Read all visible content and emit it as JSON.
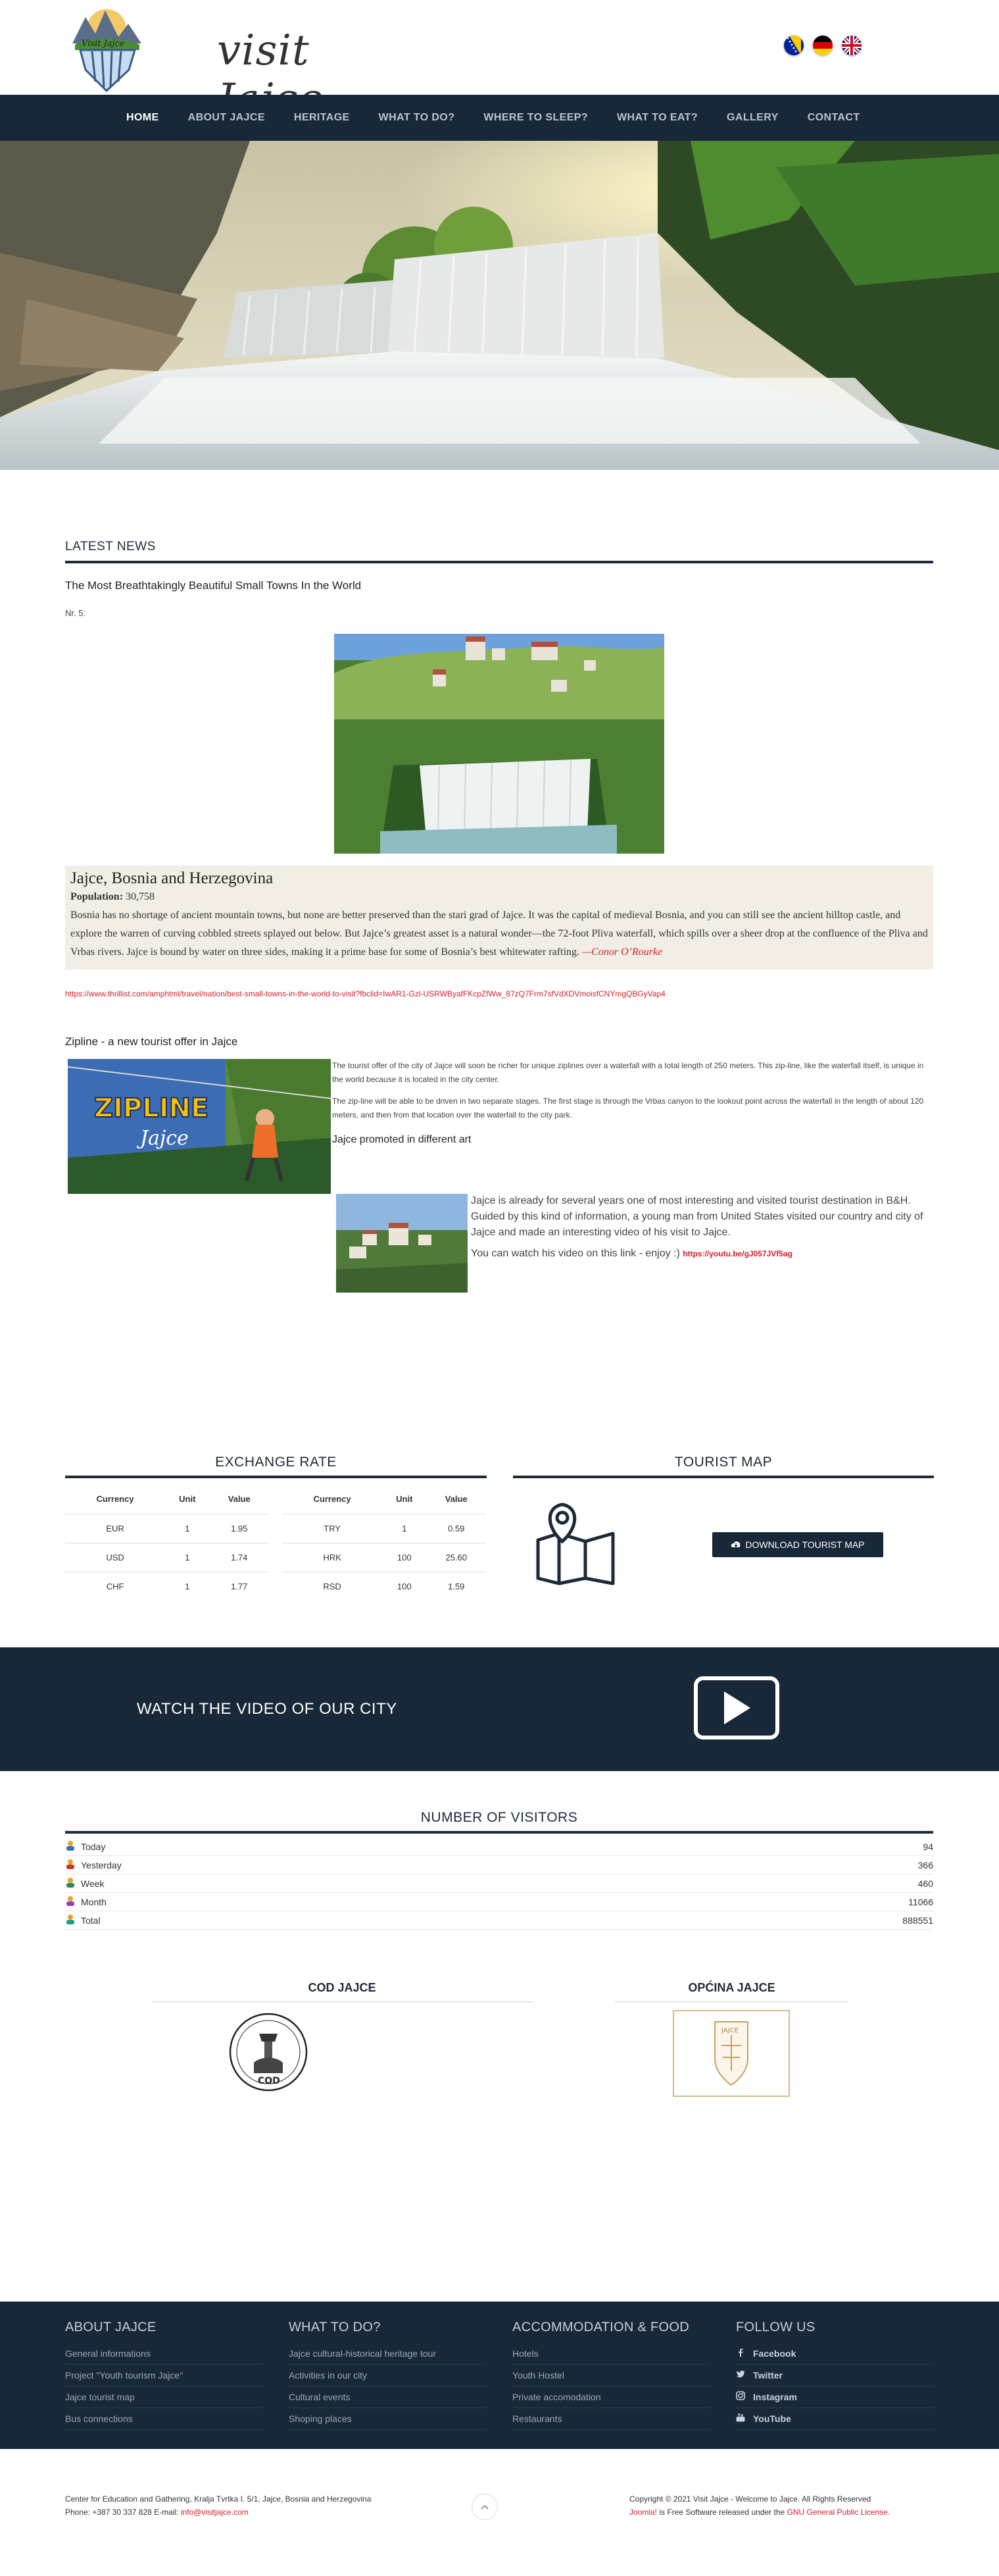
{
  "header": {
    "logo_text": "visit Jajce",
    "flags": [
      {
        "name": "bosnian-flag"
      },
      {
        "name": "german-flag"
      },
      {
        "name": "uk-flag"
      }
    ]
  },
  "nav": {
    "items": [
      {
        "label": "HOME",
        "active": true
      },
      {
        "label": "ABOUT JAJCE"
      },
      {
        "label": "HERITAGE"
      },
      {
        "label": "WHAT TO DO?"
      },
      {
        "label": "WHERE TO SLEEP?"
      },
      {
        "label": "WHAT TO EAT?"
      },
      {
        "label": "GALLERY"
      },
      {
        "label": "CONTACT"
      }
    ]
  },
  "news": {
    "title": "LATEST NEWS",
    "article1": {
      "heading": "The Most Breathtakingly Beautiful Small Towns In the World",
      "number": "Nr. 5:",
      "place": "Jajce, Bosnia and Herzegovina",
      "population_label": "Population:",
      "population": "30,758",
      "body": "Bosnia has no shortage of ancient mountain towns, but none are better preserved than the stari grad of Jajce. It was the capital of medieval Bosnia, and you can still see the ancient hilltop castle, and explore the warren of curving cobbled streets splayed out below. But Jajce’s greatest asset is a natural wonder—the 72-foot Pliva waterfall, which spills over a sheer drop at the confluence of the Pliva and Vrbas rivers. Jajce is bound by water on three sides, making it a prime base for some of Bosnia’s best whitewater rafting.",
      "author": "—Conor O’Rourke",
      "link": "https://www.thrillist.com/amphtml/travel/nation/best-small-towns-in-the-world-to-visit?fbclid=IwAR1-Gzl-USRWByafFKcpZfWw_87zQ7Frm7sfVdXDVmoisfCNYmgQBGyVap4"
    },
    "article2": {
      "heading": "Zipline - a new tourist offer in Jajce",
      "banner_line1": "ZIPLINE",
      "banner_line2": "Jajce",
      "p1": "The tourist offer of the city of Jajce will soon be richer for unique ziplines over a waterfall with a total length of 250 meters. This zip-line, like the waterfall itself, is unique in the world because it is located in the city center.",
      "p2": "The zip-line will be able to be driven in two separate stages. The first stage is through the Vrbas canyon to the lookout point across the waterfall in the length of about 120 meters, and then from that location over the waterfall to the city park."
    },
    "article3": {
      "heading": "Jajce promoted in different art",
      "p1": "Jajce is already for several years one of most interesting and visited tourist destination in B&H. Guided by this kind of information, a young man from United States visited our country and city of Jajce and made an interesting video of his visit to Jajce.",
      "p2": "You can watch his video on this link - enjoy :)",
      "link": "https://youtu.be/gJ057JVf5ag"
    }
  },
  "exchange": {
    "title": "EXCHANGE RATE",
    "headers": [
      "Currency",
      "Unit",
      "Value"
    ],
    "left": [
      [
        "EUR",
        "1",
        "1.95"
      ],
      [
        "USD",
        "1",
        "1.74"
      ],
      [
        "CHF",
        "1",
        "1.77"
      ]
    ],
    "right": [
      [
        "TRY",
        "1",
        "0.59"
      ],
      [
        "HRK",
        "100",
        "25.60"
      ],
      [
        "RSD",
        "100",
        "1.59"
      ]
    ]
  },
  "map": {
    "title": "TOURIST MAP",
    "button": "DOWNLOAD TOURIST MAP"
  },
  "video": {
    "label": "WATCH THE VIDEO OF OUR CITY"
  },
  "visitors": {
    "title": "NUMBER OF VISITORS",
    "rows": [
      {
        "label": "Today",
        "value": "94"
      },
      {
        "label": "Yesterday",
        "value": "366"
      },
      {
        "label": "Week",
        "value": "460"
      },
      {
        "label": "Month",
        "value": "11066"
      },
      {
        "label": "Total",
        "value": "888551"
      }
    ]
  },
  "partners": {
    "left": {
      "title": "COD JAJCE",
      "seal_text": "COD"
    },
    "right": {
      "title": "OPĆINA JAJCE",
      "crest_text": "JAJCE"
    }
  },
  "footer": {
    "col1": {
      "title": "ABOUT JAJCE",
      "items": [
        "General informations",
        "Project \"Youth tourism Jajce\"",
        "Jajce tourist map",
        "Bus connections"
      ]
    },
    "col2": {
      "title": "WHAT TO DO?",
      "items": [
        "Jajce cultural-historical heritage tour",
        "Activities in our city",
        "Cultural events",
        "Shoping places"
      ]
    },
    "col3": {
      "title": "ACCOMMODATION & FOOD",
      "items": [
        "Hotels",
        "Youth Hostel",
        "Private accomodation",
        "Restaurants"
      ]
    },
    "col4": {
      "title": "FOLLOW US",
      "items": [
        "Facebook",
        "Twitter",
        "Instagram",
        "YouTube"
      ]
    }
  },
  "bottom": {
    "address": "Center for Education and Gathering, Kralja Tvrtka I. 5/1, Jajce, Bosnia and Herzegovina",
    "phone": "Phone: +387 30 337 828 E-mail:",
    "email": "info@visitjajce.com",
    "copyright": "Copyright © 2021 Visit Jajce - Welcome to Jajce. All Rights Reserved",
    "joomla": "Joomla!",
    "license_text": "is Free Software released under the",
    "license_link": "GNU General Public License."
  }
}
